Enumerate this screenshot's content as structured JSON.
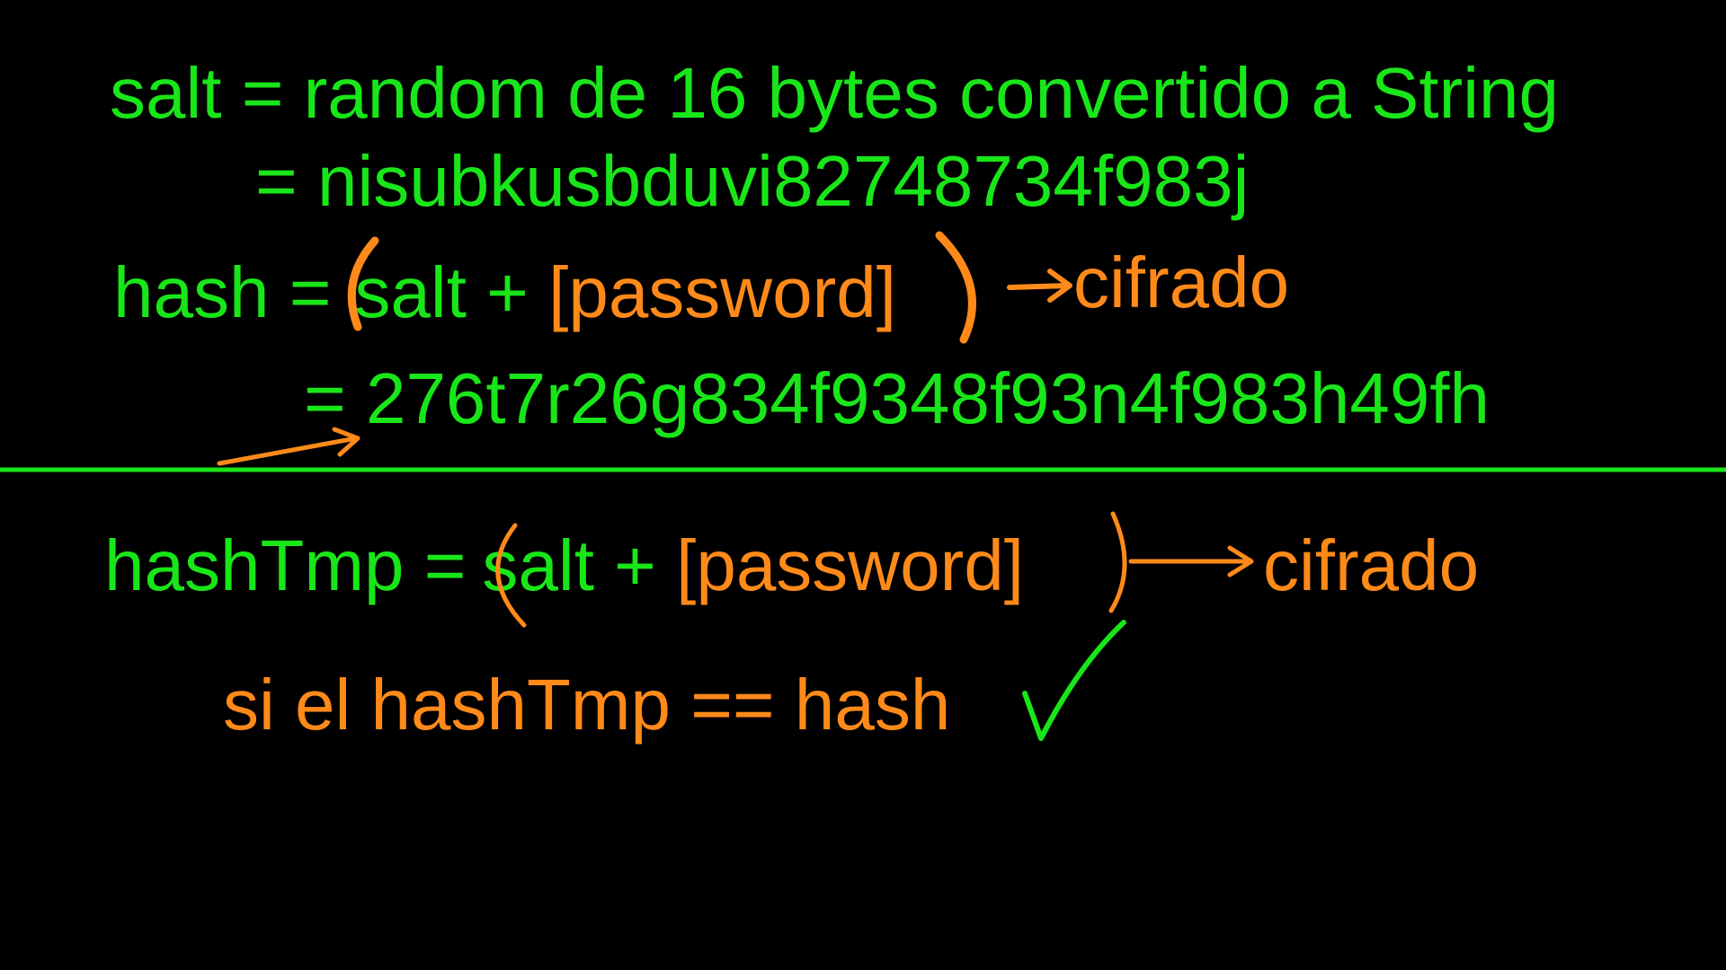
{
  "whiteboard": {
    "colors": {
      "background": "#000000",
      "green": "#19e619",
      "orange": "#ff8a1a"
    },
    "salt_line": "salt = random de 16 bytes convertido a String",
    "salt_value": "= nisubkusbduvi82748734f983j",
    "hash_line": {
      "lhs": "hash =",
      "salt_part": "salt + ",
      "password_part": "[password]"
    },
    "hash_note": "cifrado",
    "hash_value": "= 276t7r26g834f9348f93n4f983h49fh",
    "hashtmp_line": {
      "lhs": "hashTmp =",
      "salt_part": "salt + ",
      "password_part": "[password]"
    },
    "hashtmp_note": "cifrado",
    "compare_line": "si el hashTmp == hash",
    "icons": {
      "check": "check-mark-icon",
      "arrow": "arrow-right-icon"
    }
  }
}
